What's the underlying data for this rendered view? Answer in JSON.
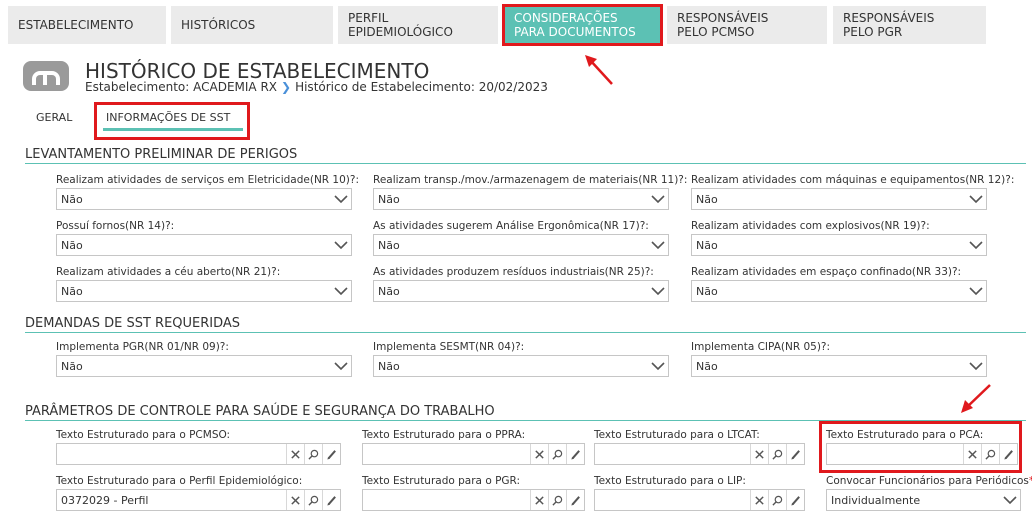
{
  "tabs": [
    {
      "label": "ESTABELECIMENTO"
    },
    {
      "label": "HISTÓRICOS"
    },
    {
      "label": "PERFIL EPIDEMIOLÓGICO"
    },
    {
      "label": "CONSIDERAÇÕES PARA DOCUMENTOS"
    },
    {
      "label": "RESPONSÁVEIS PELO PCMSO"
    },
    {
      "label": "RESPONSÁVEIS PELO PGR"
    }
  ],
  "header": {
    "title": "HISTÓRICO DE ESTABELECIMENTO",
    "crumb_estab": "Estabelecimento: ACADEMIA RX",
    "crumb_hist": "Histórico de Estabelecimento: 20/02/2023"
  },
  "subtabs": [
    {
      "label": "GERAL"
    },
    {
      "label": "INFORMAÇÕES DE SST"
    }
  ],
  "sections": {
    "perigos": "LEVANTAMENTO PRELIMINAR DE PERIGOS",
    "demandas": "DEMANDAS DE SST REQUERIDAS",
    "parametros": "PARÂMETROS DE CONTROLE PARA SAÚDE E SEGURANÇA DO TRABALHO"
  },
  "perigos": [
    {
      "label": "Realizam atividades de serviços em Eletricidade(NR 10)?:",
      "value": "Não"
    },
    {
      "label": "Realizam transp./mov./armazenagem de materiais(NR 11)?:",
      "value": "Não"
    },
    {
      "label": "Realizam atividades com máquinas e equipamentos(NR 12)?:",
      "value": "Não"
    },
    {
      "label": "Possuí fornos(NR 14)?:",
      "value": "Não"
    },
    {
      "label": "As atividades sugerem Análise Ergonômica(NR 17)?:",
      "value": "Não"
    },
    {
      "label": "Realizam atividades com explosivos(NR 19)?:",
      "value": "Não"
    },
    {
      "label": "Realizam atividades a céu aberto(NR 21)?:",
      "value": "Não"
    },
    {
      "label": "As atividades produzem resíduos industriais(NR 25)?:",
      "value": "Não"
    },
    {
      "label": "Realizam atividades em espaço confinado(NR 33)?:",
      "value": "Não"
    }
  ],
  "demandas": [
    {
      "label": "Implementa PGR(NR 01/NR 09)?:",
      "value": "Não"
    },
    {
      "label": "Implementa SESMT(NR 04)?:",
      "value": "Não"
    },
    {
      "label": "Implementa CIPA(NR 05)?:",
      "value": "Não"
    }
  ],
  "parametros": [
    {
      "label": "Texto Estruturado para o PCMSO:",
      "value": ""
    },
    {
      "label": "Texto Estruturado para o PPRA:",
      "value": ""
    },
    {
      "label": "Texto Estruturado para o LTCAT:",
      "value": ""
    },
    {
      "label": "Texto Estruturado para o PCA:",
      "value": ""
    },
    {
      "label": "Texto Estruturado para o Perfil Epidemiológico:",
      "value": "0372029 - Perfil"
    },
    {
      "label": "Texto Estruturado para o PGR:",
      "value": ""
    },
    {
      "label": "Texto Estruturado para o LIP:",
      "value": ""
    }
  ],
  "convocar": {
    "label": "Convocar Funcionários para Periódicos",
    "required_mark": "*",
    "colon": ":",
    "value": "Individualmente"
  },
  "colors": {
    "accent": "#5cc1b4",
    "highlight": "#e0191d"
  }
}
